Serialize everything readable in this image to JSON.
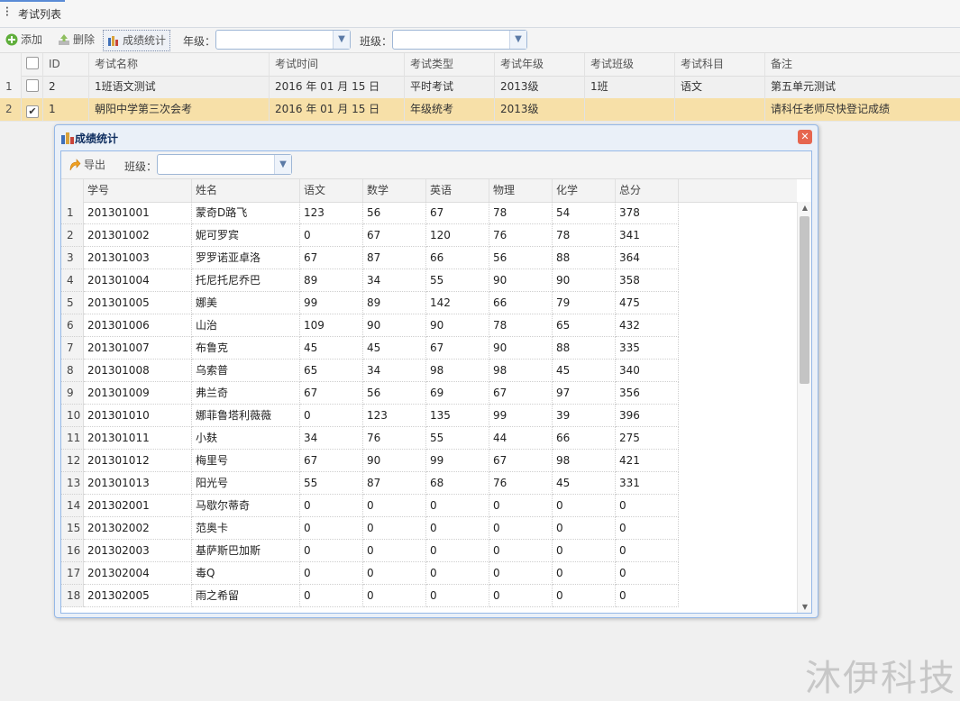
{
  "tab": {
    "title": "考试列表"
  },
  "toolbar": {
    "add_label": "添加",
    "delete_label": "删除",
    "stats_label": "成绩统计",
    "grade_label": "年级：",
    "class_label": "班级："
  },
  "exam_grid": {
    "headers": [
      "ID",
      "考试名称",
      "考试时间",
      "考试类型",
      "考试年级",
      "考试班级",
      "考试科目",
      "备注"
    ],
    "rows": [
      {
        "rownum": "1",
        "checked": false,
        "cells": [
          "2",
          "1班语文测试",
          "2016 年 01 月 15 日",
          "平时考试",
          "2013级",
          "1班",
          "语文",
          "第五单元测试"
        ]
      },
      {
        "rownum": "2",
        "checked": true,
        "cells": [
          "1",
          "朝阳中学第三次会考",
          "2016 年 01 月 15 日",
          "年级统考",
          "2013级",
          "",
          "",
          "请科任老师尽快登记成绩"
        ]
      }
    ]
  },
  "dialog": {
    "title": "成绩统计",
    "export_label": "导出",
    "class_label": "班级：",
    "headers": [
      "学号",
      "姓名",
      "语文",
      "数学",
      "英语",
      "物理",
      "化学",
      "总分"
    ],
    "rows": [
      [
        "201301001",
        "蒙奇D路飞",
        "123",
        "56",
        "67",
        "78",
        "54",
        "378"
      ],
      [
        "201301002",
        "妮可罗宾",
        "0",
        "67",
        "120",
        "76",
        "78",
        "341"
      ],
      [
        "201301003",
        "罗罗诺亚卓洛",
        "67",
        "87",
        "66",
        "56",
        "88",
        "364"
      ],
      [
        "201301004",
        "托尼托尼乔巴",
        "89",
        "34",
        "55",
        "90",
        "90",
        "358"
      ],
      [
        "201301005",
        "娜美",
        "99",
        "89",
        "142",
        "66",
        "79",
        "475"
      ],
      [
        "201301006",
        "山治",
        "109",
        "90",
        "90",
        "78",
        "65",
        "432"
      ],
      [
        "201301007",
        "布鲁克",
        "45",
        "45",
        "67",
        "90",
        "88",
        "335"
      ],
      [
        "201301008",
        "乌索普",
        "65",
        "34",
        "98",
        "98",
        "45",
        "340"
      ],
      [
        "201301009",
        "弗兰奇",
        "67",
        "56",
        "69",
        "67",
        "97",
        "356"
      ],
      [
        "201301010",
        "娜菲鲁塔利薇薇",
        "0",
        "123",
        "135",
        "99",
        "39",
        "396"
      ],
      [
        "201301011",
        "小麸",
        "34",
        "76",
        "55",
        "44",
        "66",
        "275"
      ],
      [
        "201301012",
        "梅里号",
        "67",
        "90",
        "99",
        "67",
        "98",
        "421"
      ],
      [
        "201301013",
        "阳光号",
        "55",
        "87",
        "68",
        "76",
        "45",
        "331"
      ],
      [
        "201302001",
        "马歇尔蒂奇",
        "0",
        "0",
        "0",
        "0",
        "0",
        "0"
      ],
      [
        "201302002",
        "范奥卡",
        "0",
        "0",
        "0",
        "0",
        "0",
        "0"
      ],
      [
        "201302003",
        "基萨斯巴加斯",
        "0",
        "0",
        "0",
        "0",
        "0",
        "0"
      ],
      [
        "201302004",
        "毒Q",
        "0",
        "0",
        "0",
        "0",
        "0",
        "0"
      ],
      [
        "201302005",
        "雨之希留",
        "0",
        "0",
        "0",
        "0",
        "0",
        "0"
      ]
    ]
  },
  "watermark": "沐伊科技",
  "icons": {
    "add": "plus-icon",
    "delete": "delete-icon",
    "stats": "bar-chart-icon",
    "export": "export-icon",
    "close": "close-icon"
  },
  "colors": {
    "selected_row": "#f7e0a8",
    "dialog_border": "#95b8e7",
    "close_button": "#e6664f"
  }
}
